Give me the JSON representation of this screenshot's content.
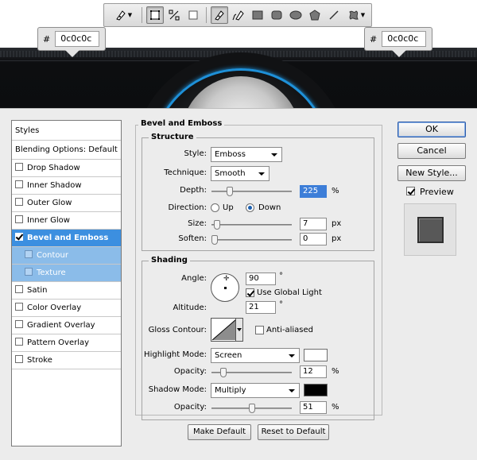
{
  "toolbar": {
    "tools": [
      {
        "name": "pen-tool-preset-icon"
      },
      {
        "name": "shape-layers-icon"
      },
      {
        "name": "paths-icon"
      },
      {
        "name": "fill-pixels-icon"
      },
      {
        "name": "pen-icon"
      },
      {
        "name": "freeform-pen-icon"
      },
      {
        "name": "rectangle-icon"
      },
      {
        "name": "rounded-rectangle-icon"
      },
      {
        "name": "ellipse-icon"
      },
      {
        "name": "polygon-icon"
      },
      {
        "name": "line-icon"
      },
      {
        "name": "custom-shape-icon"
      }
    ]
  },
  "callouts": {
    "left": {
      "hash": "#",
      "value": "0c0c0c"
    },
    "right": {
      "hash": "#",
      "value": "0c0c0c"
    }
  },
  "styles_panel": {
    "header": "Styles",
    "blending": "Blending Options: Default",
    "items": [
      {
        "label": "Drop Shadow",
        "checked": false
      },
      {
        "label": "Inner Shadow",
        "checked": false
      },
      {
        "label": "Outer Glow",
        "checked": false
      },
      {
        "label": "Inner Glow",
        "checked": false
      },
      {
        "label": "Bevel and Emboss",
        "checked": true
      },
      {
        "label": "Contour",
        "checked": false
      },
      {
        "label": "Texture",
        "checked": false
      },
      {
        "label": "Satin",
        "checked": false
      },
      {
        "label": "Color Overlay",
        "checked": false
      },
      {
        "label": "Gradient Overlay",
        "checked": false
      },
      {
        "label": "Pattern Overlay",
        "checked": false
      },
      {
        "label": "Stroke",
        "checked": false
      }
    ]
  },
  "bevel": {
    "title": "Bevel and Emboss",
    "structure": {
      "title": "Structure",
      "style_label": "Style:",
      "style_value": "Emboss",
      "technique_label": "Technique:",
      "technique_value": "Smooth",
      "depth_label": "Depth:",
      "depth_value": "225",
      "depth_unit": "%",
      "direction_label": "Direction:",
      "direction_up": "Up",
      "direction_down": "Down",
      "size_label": "Size:",
      "size_value": "7",
      "size_unit": "px",
      "soften_label": "Soften:",
      "soften_value": "0",
      "soften_unit": "px"
    },
    "shading": {
      "title": "Shading",
      "angle_label": "Angle:",
      "angle_value": "90",
      "degree": "°",
      "global_light_label": "Use Global Light",
      "altitude_label": "Altitude:",
      "altitude_value": "21",
      "gloss_label": "Gloss Contour:",
      "anti_aliased_label": "Anti-aliased",
      "highlight_label": "Highlight Mode:",
      "highlight_value": "Screen",
      "highlight_color": "#ffffff",
      "highlight_opacity_label": "Opacity:",
      "highlight_opacity_value": "12",
      "shadow_label": "Shadow Mode:",
      "shadow_value": "Multiply",
      "shadow_color": "#000000",
      "shadow_opacity_label": "Opacity:",
      "shadow_opacity_value": "51",
      "percent": "%"
    },
    "make_default": "Make Default",
    "reset_default": "Reset to Default"
  },
  "buttons": {
    "ok": "OK",
    "cancel": "Cancel",
    "new_style": "New Style...",
    "preview": "Preview"
  },
  "sliders": {
    "depth": 0.2,
    "size": 0.03,
    "soften": 0.0,
    "highlight_opacity": 0.12,
    "shadow_opacity": 0.51
  },
  "colors": {
    "accent_blue": "#3c8fe0",
    "canvas_ring": "#1e90d8"
  }
}
